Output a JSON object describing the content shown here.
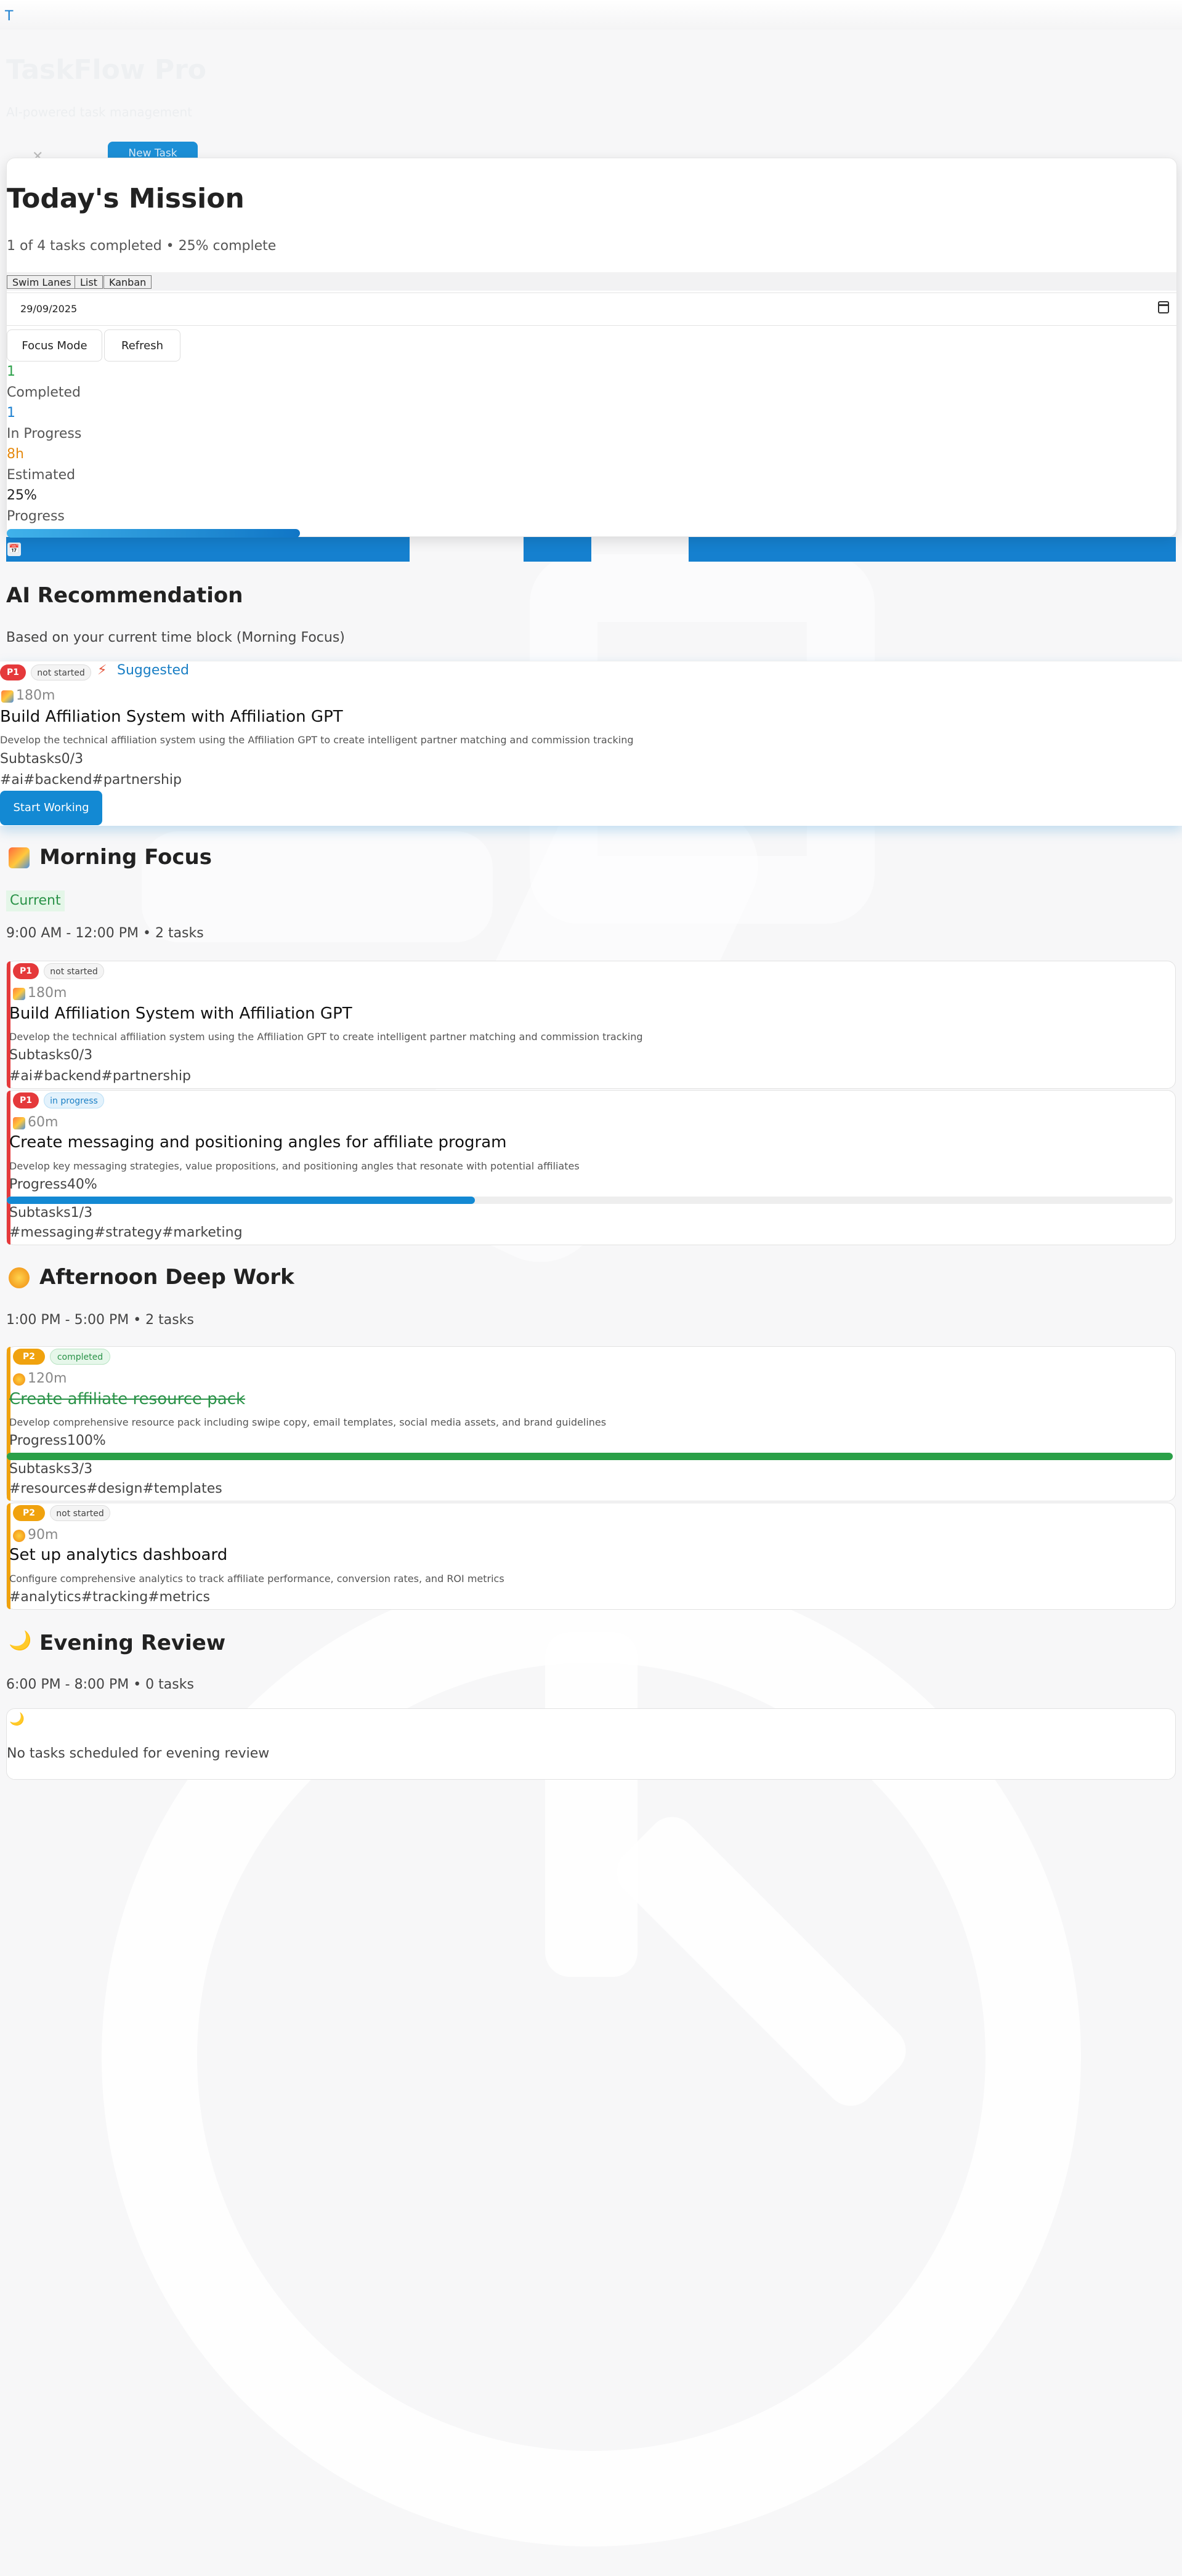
{
  "header": {
    "corner_letter": "T",
    "app_title": "TaskFlow Pro",
    "app_subtitle": "AI-powered task management",
    "new_task_label": "New Task"
  },
  "mission": {
    "title": "Today's Mission",
    "summary": "1 of 4 tasks completed • 25% complete",
    "view_buttons": [
      "Swim Lanes",
      "List",
      "Kanban"
    ],
    "date_value": "29/09/2025",
    "focus_label": "Focus Mode",
    "refresh_label": "Refresh",
    "stats": [
      {
        "value": "1",
        "label": "Completed",
        "color": "#2aa048"
      },
      {
        "value": "1",
        "label": "In Progress",
        "color": "#1a7fd0"
      },
      {
        "value": "8h",
        "label": "Estimated",
        "color": "#e58a10"
      },
      {
        "value": "25%",
        "label": "Progress",
        "color": "#222222"
      }
    ],
    "progress": 0.25
  },
  "ai": {
    "title": "AI Recommendation",
    "subtitle": "Based on your current time block (Morning Focus)",
    "priority": "P1",
    "status": "not started",
    "suggested": "Suggested",
    "duration": "180m",
    "task_title": "Build Affiliation System with Affiliation GPT",
    "task_desc": "Develop the technical affiliation system using the Affiliation GPT to create intelligent partner matching and commission tracking",
    "subtasks_label": "Subtasks",
    "subtasks": "0/3",
    "tags": [
      "#ai",
      "#backend",
      "#partnership"
    ],
    "start_label": "Start Working"
  },
  "morning": {
    "title": "Morning Focus",
    "current": "Current",
    "summary": "9:00 AM - 12:00 PM • 2 tasks",
    "tasks": [
      {
        "priority": "P1",
        "status": "not started",
        "duration": "180m",
        "title": "Build Affiliation System with Affiliation GPT",
        "desc": "Develop the technical affiliation system using the Affiliation GPT to create intelligent partner matching and commission tracking",
        "subtasks": "0/3",
        "tags": [
          "#ai",
          "#backend",
          "#partnership"
        ]
      },
      {
        "priority": "P1",
        "status": "in progress",
        "duration": "60m",
        "title": "Create messaging and positioning angles for affiliate program",
        "desc": "Develop key messaging strategies, value propositions, and positioning angles that resonate with potential affiliates",
        "progress_label": "Progress",
        "progress_text": "40%",
        "progress": 0.4,
        "subtasks": "1/3",
        "tags": [
          "#messaging",
          "#strategy",
          "#marketing"
        ]
      }
    ]
  },
  "afternoon": {
    "title": "Afternoon Deep Work",
    "summary": "1:00 PM - 5:00 PM • 2 tasks",
    "tasks": [
      {
        "priority": "P2",
        "status": "completed",
        "duration": "120m",
        "title": "Create affiliate resource pack",
        "desc": "Develop comprehensive resource pack including swipe copy, email templates, social media assets, and brand guidelines",
        "progress_label": "Progress",
        "progress_text": "100%",
        "progress": 1.0,
        "subtasks": "3/3",
        "tags": [
          "#resources",
          "#design",
          "#templates"
        ]
      },
      {
        "priority": "P2",
        "status": "not started",
        "duration": "90m",
        "title": "Set up analytics dashboard",
        "desc": "Configure comprehensive analytics to track affiliate performance, conversion rates, and ROI metrics",
        "tags": [
          "#analytics",
          "#tracking",
          "#metrics"
        ]
      }
    ]
  },
  "evening": {
    "title": "Evening Review",
    "summary": "6:00 PM - 8:00 PM • 0 tasks",
    "empty": "No tasks scheduled for evening review"
  },
  "labels": {
    "subtasks": "Subtasks"
  },
  "colors": {
    "primary": "#1389d3",
    "p1": "#e5393b",
    "p2": "#f0a20e",
    "success": "#2aa048"
  }
}
